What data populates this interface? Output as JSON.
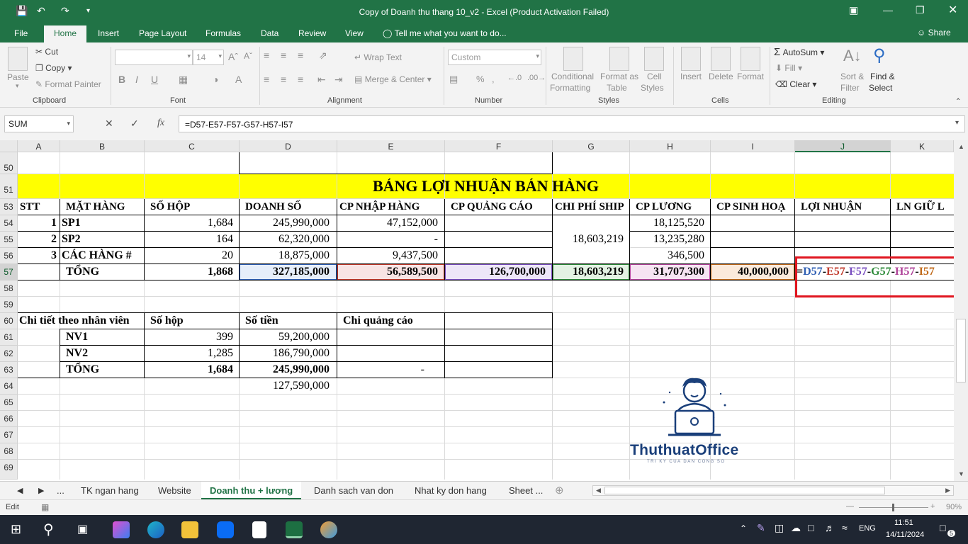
{
  "titlebar": {
    "title": "Copy of Doanh thu thang 10_v2 - Excel (Product Activation Failed)"
  },
  "menu": {
    "tabs": [
      "File",
      "Home",
      "Insert",
      "Page Layout",
      "Formulas",
      "Data",
      "Review",
      "View"
    ],
    "tell_me": "Tell me what you want to do...",
    "share": "Share"
  },
  "ribbon": {
    "clipboard": {
      "paste": "Paste",
      "cut": "Cut",
      "copy": "Copy",
      "format_painter": "Format Painter",
      "label": "Clipboard"
    },
    "font": {
      "font_size": "14",
      "bold": "B",
      "italic": "I",
      "underline": "U",
      "label": "Font"
    },
    "alignment": {
      "wrap_text": "Wrap Text",
      "merge_center": "Merge & Center",
      "label": "Alignment"
    },
    "number": {
      "format": "Custom",
      "label": "Number"
    },
    "styles": {
      "conditional_formatting_1": "Conditional",
      "conditional_formatting_2": "Formatting",
      "format_as_table_1": "Format as",
      "format_as_table_2": "Table",
      "cell_styles_1": "Cell",
      "cell_styles_2": "Styles",
      "label": "Styles"
    },
    "cells": {
      "insert": "Insert",
      "delete": "Delete",
      "format": "Format",
      "label": "Cells"
    },
    "editing": {
      "autosum": "AutoSum",
      "fill": "Fill",
      "clear": "Clear",
      "sort_filter_1": "Sort &",
      "sort_filter_2": "Filter",
      "find_select_1": "Find &",
      "find_select_2": "Select",
      "label": "Editing"
    }
  },
  "formula_bar": {
    "name_box": "SUM",
    "fx": "fx",
    "formula": "=D57-E57-F57-G57-H57-I57"
  },
  "columns": [
    "A",
    "B",
    "C",
    "D",
    "E",
    "F",
    "G",
    "H",
    "I",
    "J",
    "K"
  ],
  "rows": [
    "50",
    "51",
    "53",
    "54",
    "55",
    "56",
    "57",
    "58",
    "59",
    "60",
    "61",
    "62",
    "63",
    "64",
    "65",
    "66",
    "67",
    "68",
    "69"
  ],
  "sheet": {
    "title": "BẢNG LỢI NHUẬN BÁN HÀNG",
    "headers": [
      "STT",
      "MẶT HÀNG",
      "SỐ HỘP",
      "DOANH SỐ",
      "CP NHẬP HÀNG",
      "CP QUẢNG CÁO",
      "CHI PHÍ SHIP",
      "CP LƯƠNG",
      "CP SINH HOẠ",
      "LỢI NHUẬN",
      "LN GIỮ L"
    ],
    "r54": {
      "stt": "1",
      "item": "SP1",
      "qty": "1,684",
      "sales": "245,990,000",
      "import": "47,152,000",
      "salary": "18,125,520"
    },
    "r55": {
      "stt": "2",
      "item": "SP2",
      "qty": "164",
      "sales": "62,320,000",
      "import": "-",
      "ship": "18,603,219",
      "salary": "13,235,280"
    },
    "r56": {
      "stt": "3",
      "item": "CÁC HÀNG #",
      "qty": "20",
      "sales": "18,875,000",
      "import": "9,437,500",
      "salary": "346,500"
    },
    "r57": {
      "item": "TỔNG",
      "qty": "1,868",
      "sales": "327,185,000",
      "import": "56,589,500",
      "ads": "126,700,000",
      "ship": "18,603,219",
      "salary": "31,707,300",
      "living": "40,000,000"
    },
    "r57_formula": [
      "=",
      "D57",
      "-",
      "E57",
      "-",
      "F57",
      "-",
      "G57",
      "-",
      "H57",
      "-",
      "I57"
    ],
    "detail": {
      "h1": "Chi tiết theo nhân viên",
      "h2": "Số hộp",
      "h3": "Số tiền",
      "h4": "Chi quảng cáo",
      "r61": {
        "name": "NV1",
        "qty": "399",
        "amount": "59,200,000"
      },
      "r62": {
        "name": "NV2",
        "qty": "1,285",
        "amount": "186,790,000"
      },
      "r63": {
        "name": "TỔNG",
        "qty": "1,684",
        "amount": "245,990,000",
        "ads": "-"
      },
      "r64": {
        "amount": "127,590,000"
      }
    }
  },
  "formula_colors": {
    "D": "#2f5fb3",
    "E": "#c0392b",
    "F": "#7a4fc0",
    "G": "#2e8b3a",
    "H": "#b0449a",
    "I": "#c06a1a",
    "highlight": "#e0151f"
  },
  "brand": {
    "name": "ThuthuatOffice",
    "tagline": "TRI KY CUA DAN CONG SO"
  },
  "sheet_tabs": {
    "more": "...",
    "tabs": [
      "TK ngan hang",
      "Website",
      "Doanh thu + lương",
      "Danh sach van don",
      "Nhat ky don hang",
      "Sheet ..."
    ]
  },
  "status": {
    "mode": "Edit",
    "zoom": "90%"
  },
  "taskbar": {
    "lang": "ENG",
    "time": "11:51",
    "date": "14/11/2024",
    "notif": "5"
  }
}
